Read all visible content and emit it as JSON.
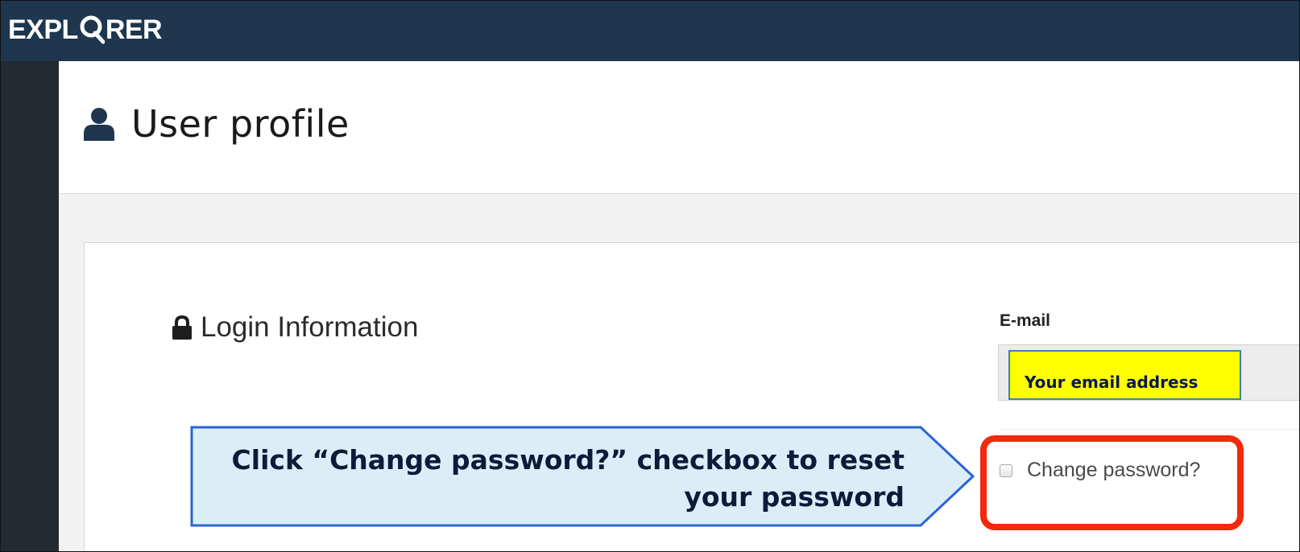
{
  "app": {
    "brand_before_o": "EXPL",
    "brand_after_o": "RER",
    "brand_o_icon": "magnifier-o-icon"
  },
  "colors": {
    "topbar": "#1e364e",
    "left_rail": "#232a30",
    "content_bg": "#f2f2f2",
    "callout_fill": "#dbeef8",
    "callout_border": "#2a63d4",
    "highlight_border": "#f2290c",
    "email_callout_fill": "#ffff00"
  },
  "header": {
    "title_icon": "user-icon",
    "title": "User profile"
  },
  "login_section": {
    "icon": "lock-icon",
    "title": "Login Information",
    "email_label": "E-mail",
    "email_annotation": "Your email address",
    "change_password_checked": false,
    "change_password_label": "Change password?"
  },
  "annotation": {
    "callout_line1": "Click “Change password?” checkbox to reset",
    "callout_line2": "your password"
  }
}
